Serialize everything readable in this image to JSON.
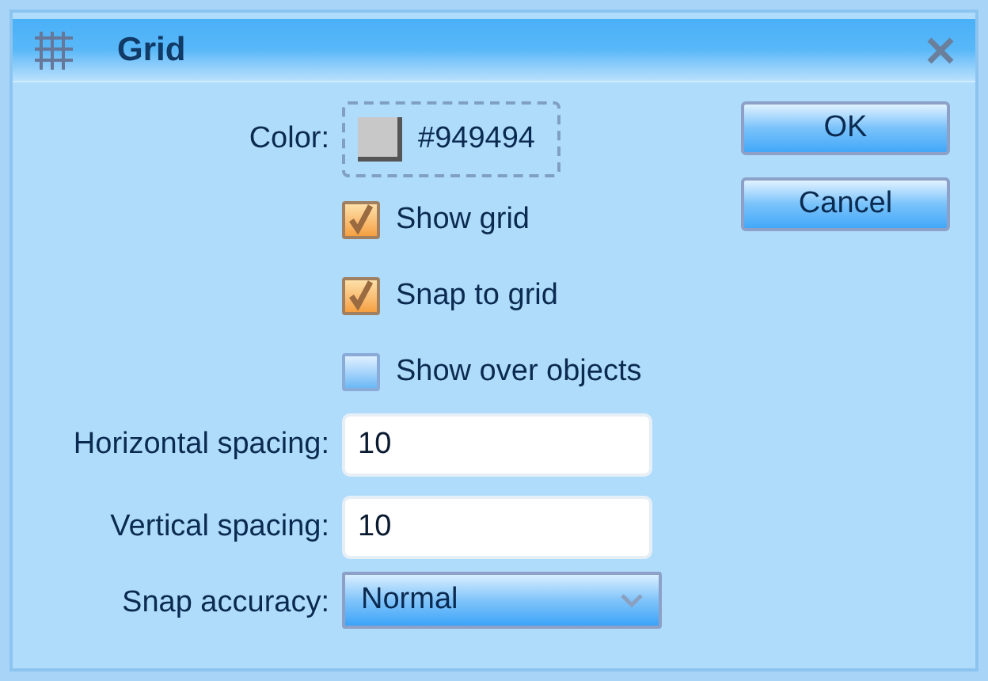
{
  "window": {
    "title": "Grid"
  },
  "color": {
    "label": "Color:",
    "value": "#949494"
  },
  "checkboxes": [
    {
      "label": "Show grid",
      "checked": true
    },
    {
      "label": "Snap to grid",
      "checked": true
    },
    {
      "label": "Show over objects",
      "checked": false
    }
  ],
  "fields": [
    {
      "label": "Horizontal spacing:",
      "value": "10"
    },
    {
      "label": "Vertical spacing:",
      "value": "10"
    }
  ],
  "snap_accuracy": {
    "label": "Snap accuracy:",
    "value": "Normal"
  },
  "buttons": [
    "OK",
    "Cancel"
  ]
}
